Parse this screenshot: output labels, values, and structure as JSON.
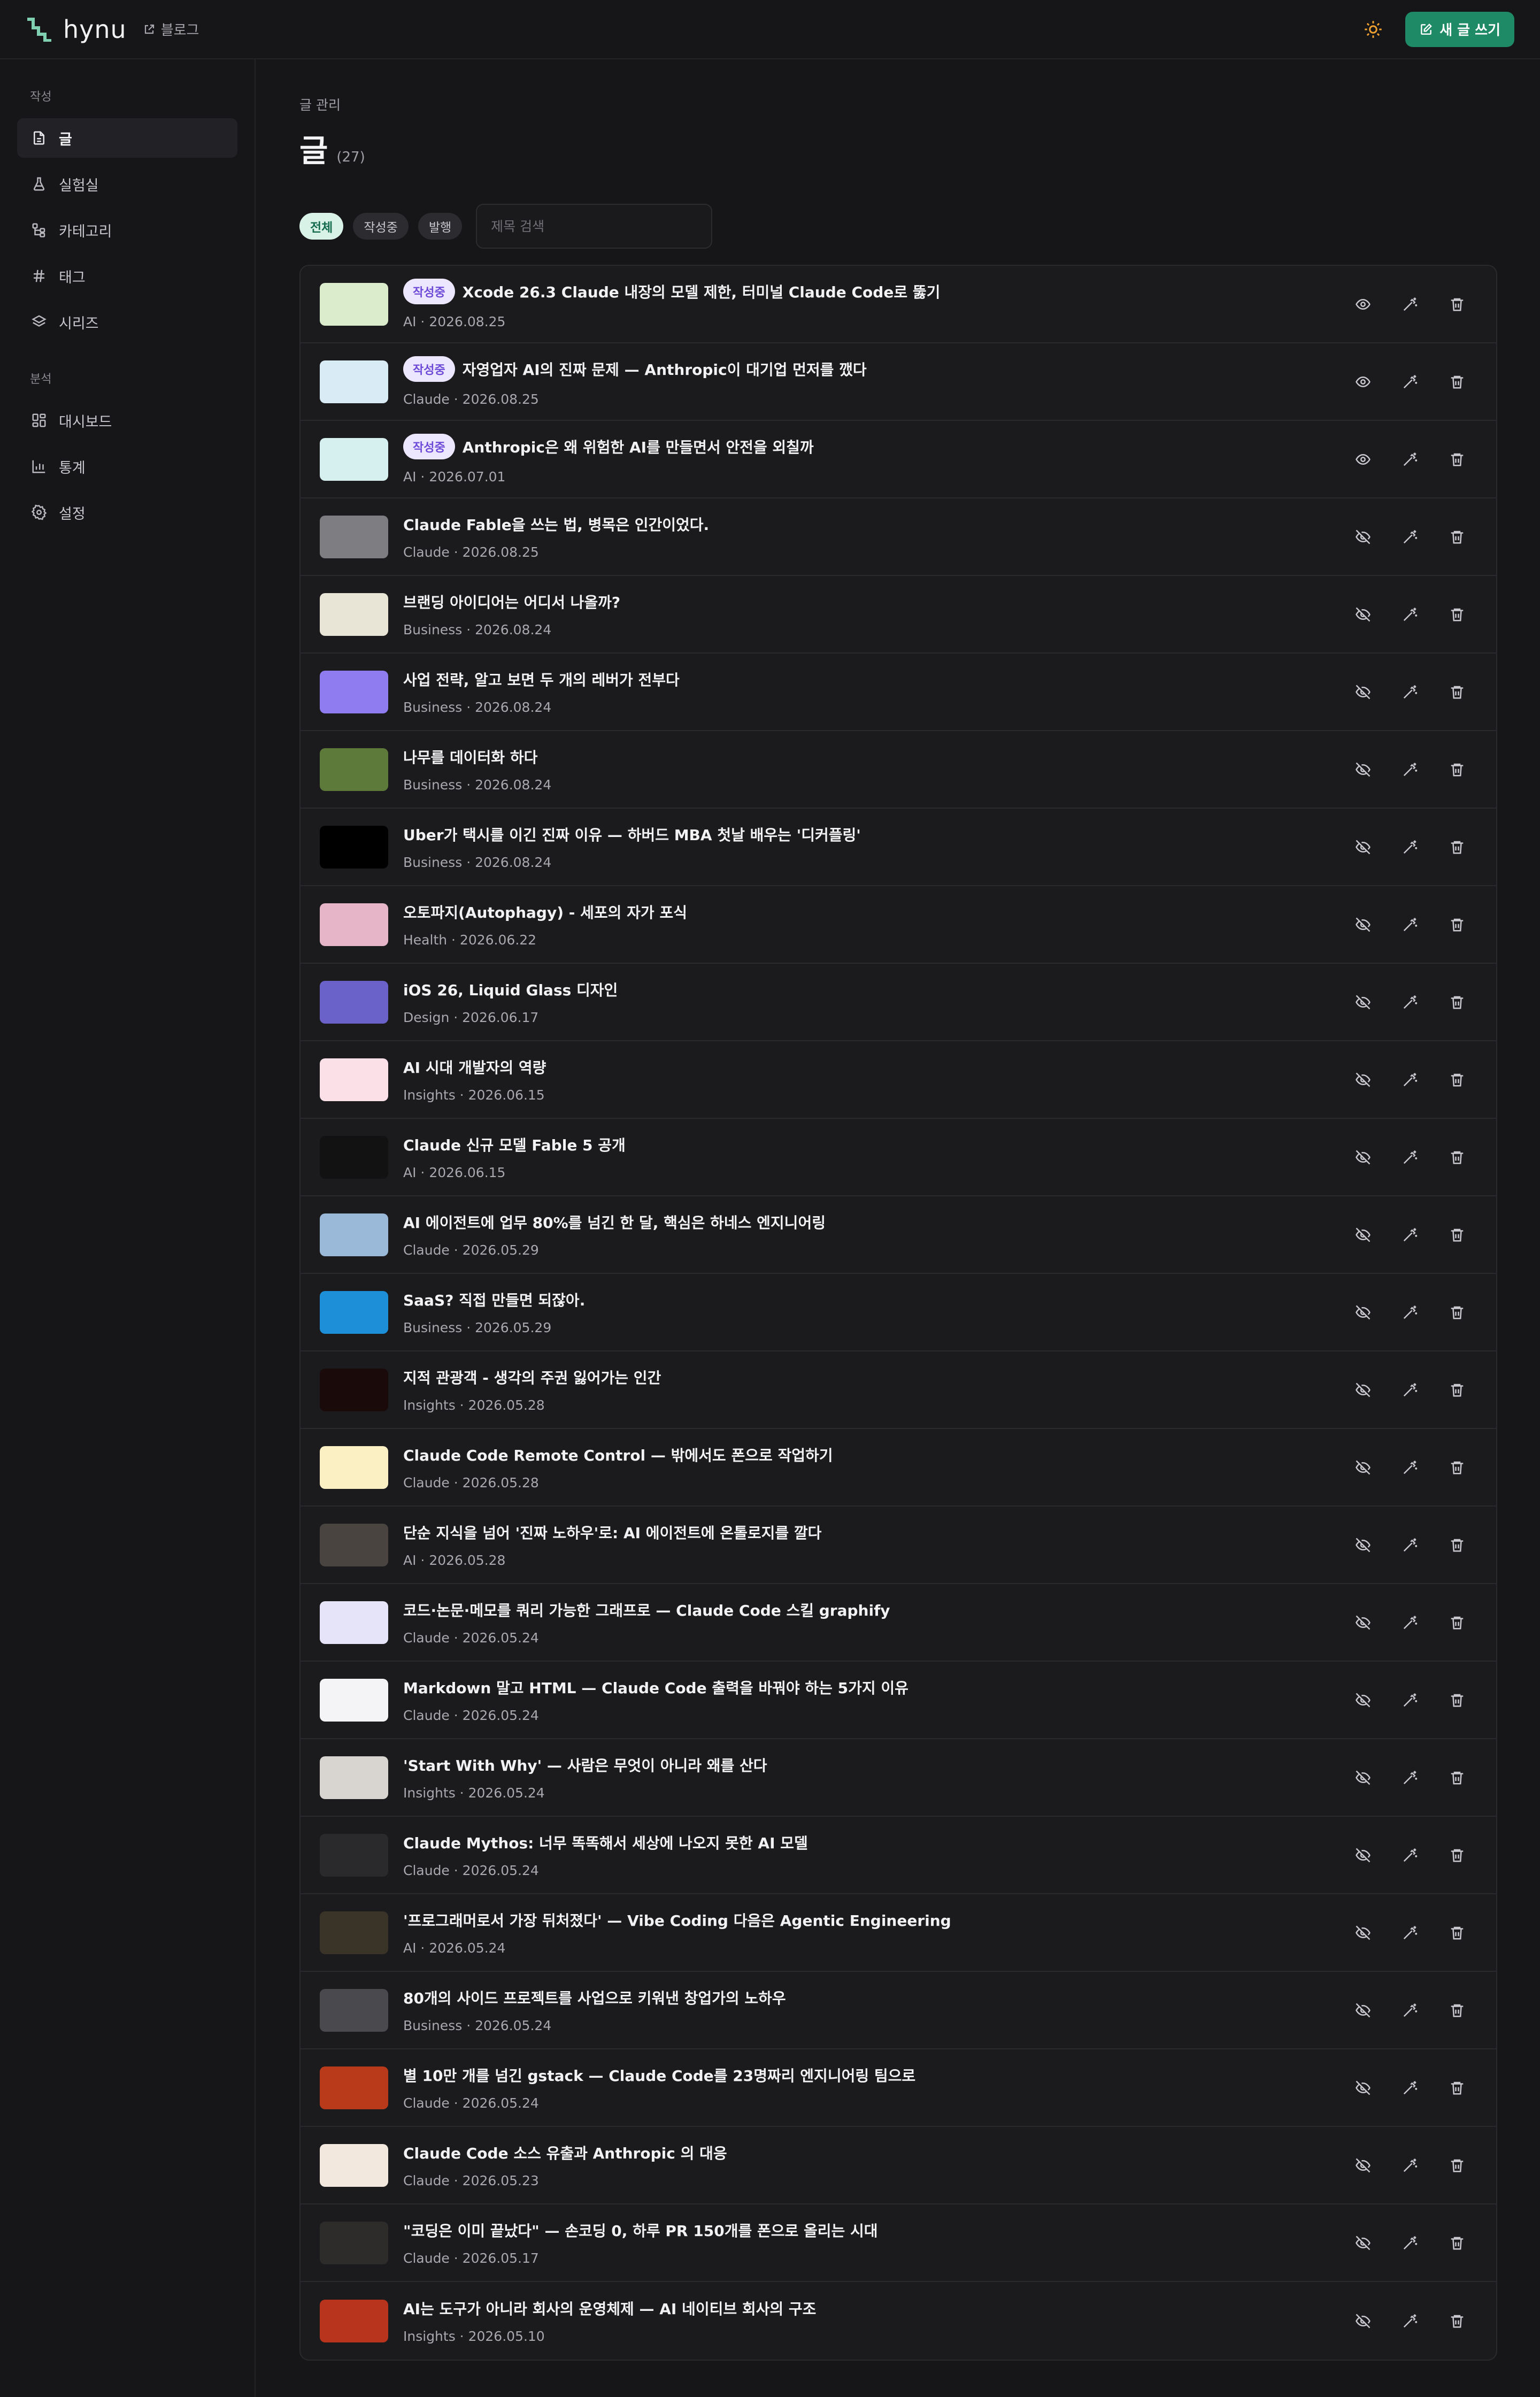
{
  "brand": {
    "logo_text": "hynu",
    "blog_link": "블로그"
  },
  "header": {
    "new_post_label": "새 글 쓰기"
  },
  "sidebar": {
    "section_write": "작성",
    "section_analytics": "분석",
    "items": [
      {
        "label": "글",
        "icon": "document-icon"
      },
      {
        "label": "실험실",
        "icon": "flask-icon"
      },
      {
        "label": "카테고리",
        "icon": "category-tree-icon"
      },
      {
        "label": "태그",
        "icon": "hash-icon"
      },
      {
        "label": "시리즈",
        "icon": "layers-icon"
      },
      {
        "label": "대시보드",
        "icon": "dashboard-icon"
      },
      {
        "label": "통계",
        "icon": "bar-chart-icon"
      },
      {
        "label": "설정",
        "icon": "gear-icon"
      }
    ]
  },
  "page": {
    "breadcrumb": "글 관리",
    "title": "글",
    "count": "(27)"
  },
  "filters": {
    "all": "전체",
    "drafts": "작성중",
    "published": "발행",
    "search_placeholder": "제목 검색"
  },
  "badge_label": "작성중",
  "posts": [
    {
      "title": "Xcode 26.3 Claude 내장의 모델 제한, 터미널 Claude Code로 뚫기",
      "meta": "AI · 2026.08.25",
      "draft": true,
      "thumb": "#dbeccc"
    },
    {
      "title": "자영업자 AI의 진짜 문제 — Anthropic이 대기업 먼저를 깼다",
      "meta": "Claude · 2026.08.25",
      "draft": true,
      "thumb": "#d9ecf6"
    },
    {
      "title": "Anthropic은 왜 위험한 AI를 만들면서 안전을 외칠까",
      "meta": "AI · 2026.07.01",
      "draft": true,
      "thumb": "#d6f0f0"
    },
    {
      "title": "Claude Fable을 쓰는 법, 병목은 인간이었다.",
      "meta": "Claude · 2026.08.25",
      "draft": false,
      "thumb": "#7e7e82"
    },
    {
      "title": "브랜딩 아이디어는 어디서 나올까?",
      "meta": "Business · 2026.08.24",
      "draft": false,
      "thumb": "#e8e4d6"
    },
    {
      "title": "사업 전략, 알고 보면 두 개의 레버가 전부다",
      "meta": "Business · 2026.08.24",
      "draft": false,
      "thumb": "#8f7cf0"
    },
    {
      "title": "나무를 데이터화 하다",
      "meta": "Business · 2026.08.24",
      "draft": false,
      "thumb": "#5e7a3a"
    },
    {
      "title": "Uber가 택시를 이긴 진짜 이유 — 하버드 MBA 첫날 배우는 '디커플링'",
      "meta": "Business · 2026.08.24",
      "draft": false,
      "thumb": "#000000"
    },
    {
      "title": "오토파지(Autophagy) - 세포의 자가 포식",
      "meta": "Health · 2026.06.22",
      "draft": false,
      "thumb": "#e6b6c8"
    },
    {
      "title": "iOS 26, Liquid Glass 디자인",
      "meta": "Design · 2026.06.17",
      "draft": false,
      "thumb": "#6a62c8"
    },
    {
      "title": "AI 시대 개발자의 역량",
      "meta": "Insights · 2026.06.15",
      "draft": false,
      "thumb": "#fbe0e8"
    },
    {
      "title": "Claude 신규 모델 Fable 5 공개",
      "meta": "AI · 2026.06.15",
      "draft": false,
      "thumb": "#121212"
    },
    {
      "title": "AI 에이전트에 업무 80%를 넘긴 한 달, 핵심은 하네스 엔지니어링",
      "meta": "Claude · 2026.05.29",
      "draft": false,
      "thumb": "#9ab8d8"
    },
    {
      "title": "SaaS? 직접 만들면 되잖아.",
      "meta": "Business · 2026.05.29",
      "draft": false,
      "thumb": "#1d8fd8"
    },
    {
      "title": "지적 관광객 - 생각의 주권 잃어가는 인간",
      "meta": "Insights · 2026.05.28",
      "draft": false,
      "thumb": "#1a0a0a"
    },
    {
      "title": "Claude Code Remote Control — 밖에서도 폰으로 작업하기",
      "meta": "Claude · 2026.05.28",
      "draft": false,
      "thumb": "#fbefc4"
    },
    {
      "title": "단순 지식을 넘어 '진짜 노하우'로: AI 에이전트에 온톨로지를 깔다",
      "meta": "AI · 2026.05.28",
      "draft": false,
      "thumb": "#4a4440"
    },
    {
      "title": "코드·논문·메모를 쿼리 가능한 그래프로 — Claude Code 스킬 graphify",
      "meta": "Claude · 2026.05.24",
      "draft": false,
      "thumb": "#e6e4f8"
    },
    {
      "title": "Markdown 말고 HTML — Claude Code 출력을 바꿔야 하는 5가지 이유",
      "meta": "Claude · 2026.05.24",
      "draft": false,
      "thumb": "#f4f4f6"
    },
    {
      "title": "'Start With Why' — 사람은 무엇이 아니라 왜를 산다",
      "meta": "Insights · 2026.05.24",
      "draft": false,
      "thumb": "#d8d4d0"
    },
    {
      "title": "Claude Mythos: 너무 똑똑해서 세상에 나오지 못한 AI 모델",
      "meta": "Claude · 2026.05.24",
      "draft": false,
      "thumb": "#2a2a2c"
    },
    {
      "title": "'프로그래머로서 가장 뒤처졌다' — Vibe Coding 다음은 Agentic Engineering",
      "meta": "AI · 2026.05.24",
      "draft": false,
      "thumb": "#3a3428"
    },
    {
      "title": "80개의 사이드 프로젝트를 사업으로 키워낸 창업가의 노하우",
      "meta": "Business · 2026.05.24",
      "draft": false,
      "thumb": "#4a4a4e"
    },
    {
      "title": "별 10만 개를 넘긴 gstack — Claude Code를 23명짜리 엔지니어링 팀으로",
      "meta": "Claude · 2026.05.24",
      "draft": false,
      "thumb": "#b83a1a"
    },
    {
      "title": "Claude Code 소스 유출과 Anthropic 의 대응",
      "meta": "Claude · 2026.05.23",
      "draft": false,
      "thumb": "#f2e8de"
    },
    {
      "title": "\"코딩은 이미 끝났다\" — 손코딩 0, 하루 PR 150개를 폰으로 올리는 시대",
      "meta": "Claude · 2026.05.17",
      "draft": false,
      "thumb": "#2e2c2a"
    },
    {
      "title": "AI는 도구가 아니라 회사의 운영체제 — AI 네이티브 회사의 구조",
      "meta": "Insights · 2026.05.10",
      "draft": false,
      "thumb": "#b8341c"
    }
  ]
}
